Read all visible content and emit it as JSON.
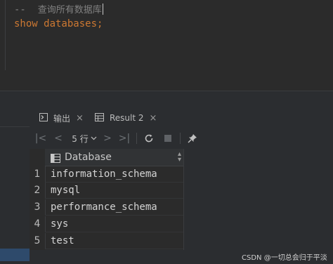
{
  "editor": {
    "comment_prefix": "--  ",
    "comment_text": "查询所有数据库",
    "sql_line": "show databases;"
  },
  "tabs": [
    {
      "label": "输出",
      "icon": "output-console-icon",
      "close": "×"
    },
    {
      "label": "Result 2",
      "icon": "table-grid-icon",
      "close": "×"
    }
  ],
  "toolbar": {
    "first": "|<",
    "prev": "<",
    "rows_label": "5 行",
    "next": ">",
    "last": ">|",
    "icons": [
      "first-page-icon",
      "previous-page-icon",
      "next-page-icon",
      "last-page-icon",
      "refresh-icon",
      "stop-icon",
      "pin-icon"
    ]
  },
  "grid": {
    "column": "Database",
    "row_numbers": [
      "1",
      "2",
      "3",
      "4",
      "5"
    ],
    "rows": [
      "information_schema",
      "mysql",
      "performance_schema",
      "sys",
      "test"
    ]
  },
  "watermark": "CSDN @一切总会归于平淡",
  "colors": {
    "keyword": "#cc7832",
    "comment": "#808080",
    "background": "#2b2b2b",
    "selection": "#2e4a6b"
  }
}
